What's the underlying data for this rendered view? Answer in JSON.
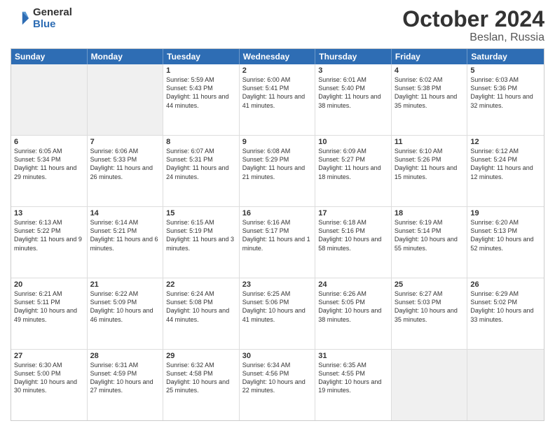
{
  "logo": {
    "line1": "General",
    "line2": "Blue"
  },
  "title": "October 2024",
  "location": "Beslan, Russia",
  "header_days": [
    "Sunday",
    "Monday",
    "Tuesday",
    "Wednesday",
    "Thursday",
    "Friday",
    "Saturday"
  ],
  "weeks": [
    [
      {
        "day": "",
        "text": "",
        "shaded": true
      },
      {
        "day": "",
        "text": "",
        "shaded": true
      },
      {
        "day": "1",
        "text": "Sunrise: 5:59 AM\nSunset: 5:43 PM\nDaylight: 11 hours and 44 minutes."
      },
      {
        "day": "2",
        "text": "Sunrise: 6:00 AM\nSunset: 5:41 PM\nDaylight: 11 hours and 41 minutes."
      },
      {
        "day": "3",
        "text": "Sunrise: 6:01 AM\nSunset: 5:40 PM\nDaylight: 11 hours and 38 minutes."
      },
      {
        "day": "4",
        "text": "Sunrise: 6:02 AM\nSunset: 5:38 PM\nDaylight: 11 hours and 35 minutes."
      },
      {
        "day": "5",
        "text": "Sunrise: 6:03 AM\nSunset: 5:36 PM\nDaylight: 11 hours and 32 minutes."
      }
    ],
    [
      {
        "day": "6",
        "text": "Sunrise: 6:05 AM\nSunset: 5:34 PM\nDaylight: 11 hours and 29 minutes."
      },
      {
        "day": "7",
        "text": "Sunrise: 6:06 AM\nSunset: 5:33 PM\nDaylight: 11 hours and 26 minutes."
      },
      {
        "day": "8",
        "text": "Sunrise: 6:07 AM\nSunset: 5:31 PM\nDaylight: 11 hours and 24 minutes."
      },
      {
        "day": "9",
        "text": "Sunrise: 6:08 AM\nSunset: 5:29 PM\nDaylight: 11 hours and 21 minutes."
      },
      {
        "day": "10",
        "text": "Sunrise: 6:09 AM\nSunset: 5:27 PM\nDaylight: 11 hours and 18 minutes."
      },
      {
        "day": "11",
        "text": "Sunrise: 6:10 AM\nSunset: 5:26 PM\nDaylight: 11 hours and 15 minutes."
      },
      {
        "day": "12",
        "text": "Sunrise: 6:12 AM\nSunset: 5:24 PM\nDaylight: 11 hours and 12 minutes."
      }
    ],
    [
      {
        "day": "13",
        "text": "Sunrise: 6:13 AM\nSunset: 5:22 PM\nDaylight: 11 hours and 9 minutes."
      },
      {
        "day": "14",
        "text": "Sunrise: 6:14 AM\nSunset: 5:21 PM\nDaylight: 11 hours and 6 minutes."
      },
      {
        "day": "15",
        "text": "Sunrise: 6:15 AM\nSunset: 5:19 PM\nDaylight: 11 hours and 3 minutes."
      },
      {
        "day": "16",
        "text": "Sunrise: 6:16 AM\nSunset: 5:17 PM\nDaylight: 11 hours and 1 minute."
      },
      {
        "day": "17",
        "text": "Sunrise: 6:18 AM\nSunset: 5:16 PM\nDaylight: 10 hours and 58 minutes."
      },
      {
        "day": "18",
        "text": "Sunrise: 6:19 AM\nSunset: 5:14 PM\nDaylight: 10 hours and 55 minutes."
      },
      {
        "day": "19",
        "text": "Sunrise: 6:20 AM\nSunset: 5:13 PM\nDaylight: 10 hours and 52 minutes."
      }
    ],
    [
      {
        "day": "20",
        "text": "Sunrise: 6:21 AM\nSunset: 5:11 PM\nDaylight: 10 hours and 49 minutes."
      },
      {
        "day": "21",
        "text": "Sunrise: 6:22 AM\nSunset: 5:09 PM\nDaylight: 10 hours and 46 minutes."
      },
      {
        "day": "22",
        "text": "Sunrise: 6:24 AM\nSunset: 5:08 PM\nDaylight: 10 hours and 44 minutes."
      },
      {
        "day": "23",
        "text": "Sunrise: 6:25 AM\nSunset: 5:06 PM\nDaylight: 10 hours and 41 minutes."
      },
      {
        "day": "24",
        "text": "Sunrise: 6:26 AM\nSunset: 5:05 PM\nDaylight: 10 hours and 38 minutes."
      },
      {
        "day": "25",
        "text": "Sunrise: 6:27 AM\nSunset: 5:03 PM\nDaylight: 10 hours and 35 minutes."
      },
      {
        "day": "26",
        "text": "Sunrise: 6:29 AM\nSunset: 5:02 PM\nDaylight: 10 hours and 33 minutes."
      }
    ],
    [
      {
        "day": "27",
        "text": "Sunrise: 6:30 AM\nSunset: 5:00 PM\nDaylight: 10 hours and 30 minutes."
      },
      {
        "day": "28",
        "text": "Sunrise: 6:31 AM\nSunset: 4:59 PM\nDaylight: 10 hours and 27 minutes."
      },
      {
        "day": "29",
        "text": "Sunrise: 6:32 AM\nSunset: 4:58 PM\nDaylight: 10 hours and 25 minutes."
      },
      {
        "day": "30",
        "text": "Sunrise: 6:34 AM\nSunset: 4:56 PM\nDaylight: 10 hours and 22 minutes."
      },
      {
        "day": "31",
        "text": "Sunrise: 6:35 AM\nSunset: 4:55 PM\nDaylight: 10 hours and 19 minutes."
      },
      {
        "day": "",
        "text": "",
        "shaded": true
      },
      {
        "day": "",
        "text": "",
        "shaded": true
      }
    ]
  ]
}
